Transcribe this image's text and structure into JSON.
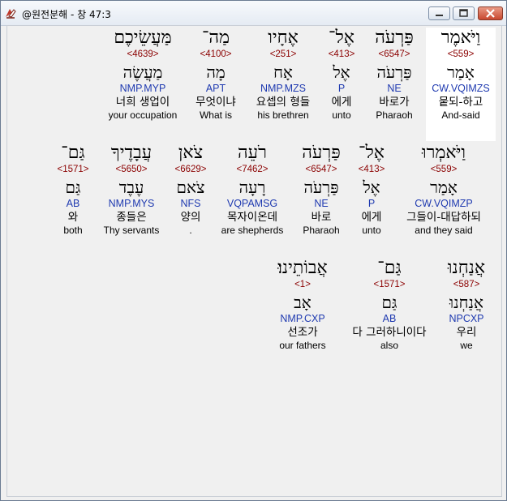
{
  "window": {
    "title": "@원전분해 - 창 47:3"
  },
  "rows": [
    {
      "words": [
        {
          "hebrew": "וַיֹּאמֶר",
          "strong": "<559>",
          "lemma": "אָמַר",
          "parse": "CW.VQIMZS",
          "korean": "뭍되-하고",
          "english": "And-said",
          "selected": true
        },
        {
          "hebrew": "פַּרְעֹה",
          "strong": "<6547>",
          "lemma": "פַּרְעֹה",
          "parse": "NE",
          "korean": "바로가",
          "english": "Pharaoh"
        },
        {
          "hebrew": "אֶל־",
          "strong": "<413>",
          "lemma": "אֶל",
          "parse": "P",
          "korean": "에게",
          "english": "unto"
        },
        {
          "hebrew": "אֶחָיו",
          "strong": "<251>",
          "lemma": "אָח",
          "parse": "NMP.MZS",
          "korean": "요셉의 형들",
          "english": "his brethren"
        },
        {
          "hebrew": "מַה־",
          "strong": "<4100>",
          "lemma": "מָה",
          "parse": "APT",
          "korean": "무엇이냐",
          "english": "What is"
        },
        {
          "hebrew": "מַּעֲשֵׂיכֶם",
          "strong": "<4639>",
          "lemma": "מַעֲשֶׂה",
          "parse": "NMP.MYP",
          "korean": "너희 생업이",
          "english": "your occupation"
        }
      ]
    },
    {
      "words": [
        {
          "hebrew": "וַיֹּאמְרוּ",
          "strong": "<559>",
          "lemma": "אָמַר",
          "parse": "CW.VQIMZP",
          "korean": "그들이-대답하되",
          "english": "and they said"
        },
        {
          "hebrew": "אֶל־",
          "strong": "<413>",
          "lemma": "אֶל",
          "parse": "P",
          "korean": "에게",
          "english": "unto"
        },
        {
          "hebrew": "פַּרְעֹה",
          "strong": "<6547>",
          "lemma": "פַּרְעֹה",
          "parse": "NE",
          "korean": "바로",
          "english": "Pharaoh"
        },
        {
          "hebrew": "רֹעֵה",
          "strong": "<7462>",
          "lemma": "רָעָה",
          "parse": "VQPAMSG",
          "korean": "목자이온데",
          "english": "are shepherds"
        },
        {
          "hebrew": "צֹאן",
          "strong": "<6629>",
          "lemma": "צֹאם",
          "parse": "NFS",
          "korean": "양의",
          "english": "."
        },
        {
          "hebrew": "עֲבָדֶיךָ",
          "strong": "<5650>",
          "lemma": "עֶבֶד",
          "parse": "NMP.MYS",
          "korean": "종들은",
          "english": "Thy servants"
        },
        {
          "hebrew": "גַּם־",
          "strong": "<1571>",
          "lemma": "גַּם",
          "parse": "AB",
          "korean": "와",
          "english": "both"
        }
      ]
    },
    {
      "words": [
        {
          "hebrew": "אֲנַחְנוּ",
          "strong": "<587>",
          "lemma": "אֲנַחְנוּ",
          "parse": "NPCXP",
          "korean": "우리",
          "english": "we"
        },
        {
          "hebrew": "גַּם־",
          "strong": "<1571>",
          "lemma": "גַּם",
          "parse": "AB",
          "korean": "다 그러하니이다",
          "english": "also"
        },
        {
          "hebrew": "אֲבוֹתֵינוּ׃",
          "strong": "<1>",
          "lemma": "אָב",
          "parse": "NMP.CXP",
          "korean": "선조가",
          "english": "our fathers"
        }
      ]
    }
  ]
}
